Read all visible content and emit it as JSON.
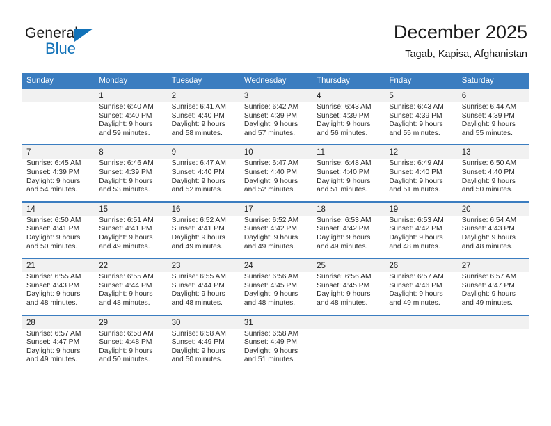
{
  "logo": {
    "word_one": "General",
    "word_two": "Blue",
    "triangle_icon": "triangle-icon",
    "accent_color": "#1272b8"
  },
  "header": {
    "title": "December 2025",
    "subtitle": "Tagab, Kapisa, Afghanistan"
  },
  "theme": {
    "header_bg": "#3b7dc0",
    "daynum_bg": "#f1f1f1",
    "cell_bg": "#ffffff",
    "text": "#2a2a2a"
  },
  "calendar": {
    "weekday_headers": [
      "Sunday",
      "Monday",
      "Tuesday",
      "Wednesday",
      "Thursday",
      "Friday",
      "Saturday"
    ],
    "weeks": [
      [
        {
          "day": "",
          "sunrise": "",
          "sunset": "",
          "daylight1": "",
          "daylight2": ""
        },
        {
          "day": "1",
          "sunrise": "Sunrise: 6:40 AM",
          "sunset": "Sunset: 4:40 PM",
          "daylight1": "Daylight: 9 hours",
          "daylight2": "and 59 minutes."
        },
        {
          "day": "2",
          "sunrise": "Sunrise: 6:41 AM",
          "sunset": "Sunset: 4:40 PM",
          "daylight1": "Daylight: 9 hours",
          "daylight2": "and 58 minutes."
        },
        {
          "day": "3",
          "sunrise": "Sunrise: 6:42 AM",
          "sunset": "Sunset: 4:39 PM",
          "daylight1": "Daylight: 9 hours",
          "daylight2": "and 57 minutes."
        },
        {
          "day": "4",
          "sunrise": "Sunrise: 6:43 AM",
          "sunset": "Sunset: 4:39 PM",
          "daylight1": "Daylight: 9 hours",
          "daylight2": "and 56 minutes."
        },
        {
          "day": "5",
          "sunrise": "Sunrise: 6:43 AM",
          "sunset": "Sunset: 4:39 PM",
          "daylight1": "Daylight: 9 hours",
          "daylight2": "and 55 minutes."
        },
        {
          "day": "6",
          "sunrise": "Sunrise: 6:44 AM",
          "sunset": "Sunset: 4:39 PM",
          "daylight1": "Daylight: 9 hours",
          "daylight2": "and 55 minutes."
        }
      ],
      [
        {
          "day": "7",
          "sunrise": "Sunrise: 6:45 AM",
          "sunset": "Sunset: 4:39 PM",
          "daylight1": "Daylight: 9 hours",
          "daylight2": "and 54 minutes."
        },
        {
          "day": "8",
          "sunrise": "Sunrise: 6:46 AM",
          "sunset": "Sunset: 4:39 PM",
          "daylight1": "Daylight: 9 hours",
          "daylight2": "and 53 minutes."
        },
        {
          "day": "9",
          "sunrise": "Sunrise: 6:47 AM",
          "sunset": "Sunset: 4:40 PM",
          "daylight1": "Daylight: 9 hours",
          "daylight2": "and 52 minutes."
        },
        {
          "day": "10",
          "sunrise": "Sunrise: 6:47 AM",
          "sunset": "Sunset: 4:40 PM",
          "daylight1": "Daylight: 9 hours",
          "daylight2": "and 52 minutes."
        },
        {
          "day": "11",
          "sunrise": "Sunrise: 6:48 AM",
          "sunset": "Sunset: 4:40 PM",
          "daylight1": "Daylight: 9 hours",
          "daylight2": "and 51 minutes."
        },
        {
          "day": "12",
          "sunrise": "Sunrise: 6:49 AM",
          "sunset": "Sunset: 4:40 PM",
          "daylight1": "Daylight: 9 hours",
          "daylight2": "and 51 minutes."
        },
        {
          "day": "13",
          "sunrise": "Sunrise: 6:50 AM",
          "sunset": "Sunset: 4:40 PM",
          "daylight1": "Daylight: 9 hours",
          "daylight2": "and 50 minutes."
        }
      ],
      [
        {
          "day": "14",
          "sunrise": "Sunrise: 6:50 AM",
          "sunset": "Sunset: 4:41 PM",
          "daylight1": "Daylight: 9 hours",
          "daylight2": "and 50 minutes."
        },
        {
          "day": "15",
          "sunrise": "Sunrise: 6:51 AM",
          "sunset": "Sunset: 4:41 PM",
          "daylight1": "Daylight: 9 hours",
          "daylight2": "and 49 minutes."
        },
        {
          "day": "16",
          "sunrise": "Sunrise: 6:52 AM",
          "sunset": "Sunset: 4:41 PM",
          "daylight1": "Daylight: 9 hours",
          "daylight2": "and 49 minutes."
        },
        {
          "day": "17",
          "sunrise": "Sunrise: 6:52 AM",
          "sunset": "Sunset: 4:42 PM",
          "daylight1": "Daylight: 9 hours",
          "daylight2": "and 49 minutes."
        },
        {
          "day": "18",
          "sunrise": "Sunrise: 6:53 AM",
          "sunset": "Sunset: 4:42 PM",
          "daylight1": "Daylight: 9 hours",
          "daylight2": "and 49 minutes."
        },
        {
          "day": "19",
          "sunrise": "Sunrise: 6:53 AM",
          "sunset": "Sunset: 4:42 PM",
          "daylight1": "Daylight: 9 hours",
          "daylight2": "and 48 minutes."
        },
        {
          "day": "20",
          "sunrise": "Sunrise: 6:54 AM",
          "sunset": "Sunset: 4:43 PM",
          "daylight1": "Daylight: 9 hours",
          "daylight2": "and 48 minutes."
        }
      ],
      [
        {
          "day": "21",
          "sunrise": "Sunrise: 6:55 AM",
          "sunset": "Sunset: 4:43 PM",
          "daylight1": "Daylight: 9 hours",
          "daylight2": "and 48 minutes."
        },
        {
          "day": "22",
          "sunrise": "Sunrise: 6:55 AM",
          "sunset": "Sunset: 4:44 PM",
          "daylight1": "Daylight: 9 hours",
          "daylight2": "and 48 minutes."
        },
        {
          "day": "23",
          "sunrise": "Sunrise: 6:55 AM",
          "sunset": "Sunset: 4:44 PM",
          "daylight1": "Daylight: 9 hours",
          "daylight2": "and 48 minutes."
        },
        {
          "day": "24",
          "sunrise": "Sunrise: 6:56 AM",
          "sunset": "Sunset: 4:45 PM",
          "daylight1": "Daylight: 9 hours",
          "daylight2": "and 48 minutes."
        },
        {
          "day": "25",
          "sunrise": "Sunrise: 6:56 AM",
          "sunset": "Sunset: 4:45 PM",
          "daylight1": "Daylight: 9 hours",
          "daylight2": "and 48 minutes."
        },
        {
          "day": "26",
          "sunrise": "Sunrise: 6:57 AM",
          "sunset": "Sunset: 4:46 PM",
          "daylight1": "Daylight: 9 hours",
          "daylight2": "and 49 minutes."
        },
        {
          "day": "27",
          "sunrise": "Sunrise: 6:57 AM",
          "sunset": "Sunset: 4:47 PM",
          "daylight1": "Daylight: 9 hours",
          "daylight2": "and 49 minutes."
        }
      ],
      [
        {
          "day": "28",
          "sunrise": "Sunrise: 6:57 AM",
          "sunset": "Sunset: 4:47 PM",
          "daylight1": "Daylight: 9 hours",
          "daylight2": "and 49 minutes."
        },
        {
          "day": "29",
          "sunrise": "Sunrise: 6:58 AM",
          "sunset": "Sunset: 4:48 PM",
          "daylight1": "Daylight: 9 hours",
          "daylight2": "and 50 minutes."
        },
        {
          "day": "30",
          "sunrise": "Sunrise: 6:58 AM",
          "sunset": "Sunset: 4:49 PM",
          "daylight1": "Daylight: 9 hours",
          "daylight2": "and 50 minutes."
        },
        {
          "day": "31",
          "sunrise": "Sunrise: 6:58 AM",
          "sunset": "Sunset: 4:49 PM",
          "daylight1": "Daylight: 9 hours",
          "daylight2": "and 51 minutes."
        },
        {
          "day": "",
          "sunrise": "",
          "sunset": "",
          "daylight1": "",
          "daylight2": ""
        },
        {
          "day": "",
          "sunrise": "",
          "sunset": "",
          "daylight1": "",
          "daylight2": ""
        },
        {
          "day": "",
          "sunrise": "",
          "sunset": "",
          "daylight1": "",
          "daylight2": ""
        }
      ]
    ]
  }
}
